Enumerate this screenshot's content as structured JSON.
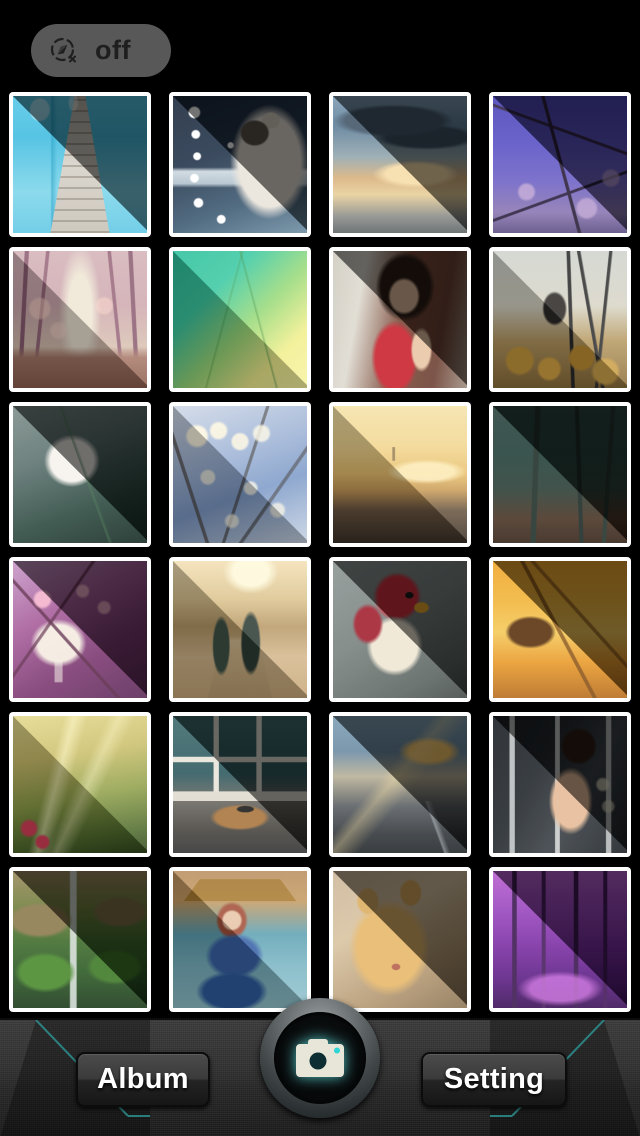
{
  "app": {
    "background_color": "#000000",
    "accent_color": "#2e8f8f",
    "shutter_glow_color": "#5ee5e5"
  },
  "topbar": {
    "geo_toggle": {
      "icon": "location-off-icon",
      "label": "off",
      "state": "off",
      "background_color": "#585858",
      "text_color": "#1f1f1f"
    }
  },
  "grid": {
    "columns": 4,
    "rows": 6,
    "count": 24,
    "thumbnails": [
      {
        "id": 1,
        "subject": "wooden pier over turquoise pool water"
      },
      {
        "id": 2,
        "subject": "white and grey cat looking out window with bokeh dots"
      },
      {
        "id": 3,
        "subject": "golden sunset clouds above sea of clouds"
      },
      {
        "id": 4,
        "subject": "full moon behind cherry blossom branches purple night"
      },
      {
        "id": 5,
        "subject": "pink misty tree-lined path with bokeh"
      },
      {
        "id": 6,
        "subject": "pink cosmos flowers against green and yellow sky"
      },
      {
        "id": 7,
        "subject": "smiling girl with bob haircut in red patterned jacket"
      },
      {
        "id": 8,
        "subject": "tuxedo cat on bench covered in autumn leaves"
      },
      {
        "id": 9,
        "subject": "white cosmos flower close-up on dark green bokeh"
      },
      {
        "id": 10,
        "subject": "dew drops on branches with blue bokeh"
      },
      {
        "id": 11,
        "subject": "hazy golden sunrise over field with distant tower"
      },
      {
        "id": 12,
        "subject": "sunlight streaming through dark green forest"
      },
      {
        "id": 13,
        "subject": "wine glass with blossom branches on purple bokeh"
      },
      {
        "id": 14,
        "subject": "couple holding hands walking on sunlit boardwalk"
      },
      {
        "id": 15,
        "subject": "red cardinal bird perched on branch"
      },
      {
        "id": 16,
        "subject": "hand reaching toward golden sunset grass"
      },
      {
        "id": 17,
        "subject": "sun rays through green forest canopy"
      },
      {
        "id": 18,
        "subject": "old book on table by rainy window"
      },
      {
        "id": 19,
        "subject": "sun rays over clouds above river valley"
      },
      {
        "id": 20,
        "subject": "woman in black dress among metal columns"
      },
      {
        "id": 21,
        "subject": "mossy green waterfall canyon"
      },
      {
        "id": 22,
        "subject": "red-haired woman with blue folding fan at pagoda"
      },
      {
        "id": 23,
        "subject": "ginger kitten close-up"
      },
      {
        "id": 24,
        "subject": "purple magenta forest path"
      }
    ]
  },
  "bottombar": {
    "album_button": {
      "label": "Album",
      "icon": "album-button"
    },
    "shutter_button": {
      "icon": "camera-icon",
      "label": ""
    },
    "setting_button": {
      "label": "Setting",
      "icon": "setting-button"
    }
  }
}
